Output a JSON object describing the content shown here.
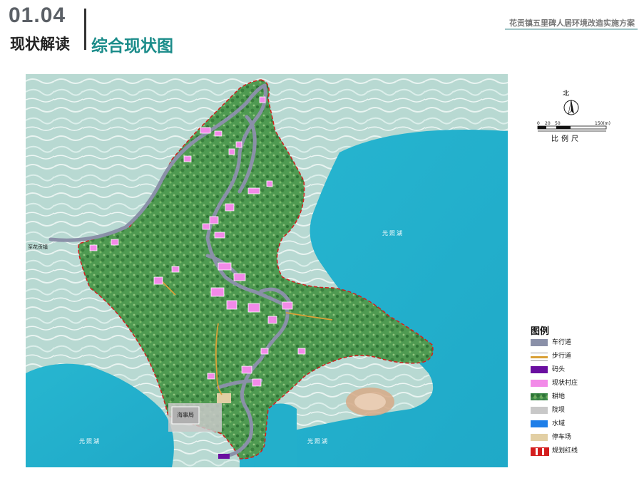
{
  "header": {
    "section_number": "01.04",
    "section_title": "现状解读",
    "page_title": "综合现状图",
    "project_title": "花贡镇五里碑人居环境改造实施方案"
  },
  "compass": {
    "north_label": "北"
  },
  "scale": {
    "ticks": [
      "0",
      "20",
      "50",
      "150(m)"
    ],
    "label": "比例尺"
  },
  "map_labels": {
    "lake_east": "光照湖",
    "lake_southwest": "光照湖",
    "lake_south": "光照湖",
    "road_destination": "至花贡镇",
    "building": "海事局"
  },
  "legend": {
    "title": "图例",
    "items": [
      {
        "label": "车行道",
        "color": "#8a90a8",
        "style": "solid"
      },
      {
        "label": "步行道",
        "color": "#d9a036",
        "style": "line"
      },
      {
        "label": "码头",
        "color": "#6a0fa0",
        "style": "solid"
      },
      {
        "label": "现状村庄",
        "color": "#f28ae8",
        "style": "solid"
      },
      {
        "label": "耕地",
        "color": "#3e8a4a",
        "style": "texture"
      },
      {
        "label": "院坝",
        "color": "#c8c8c8",
        "style": "solid"
      },
      {
        "label": "水域",
        "color": "#1e7ee8",
        "style": "solid"
      },
      {
        "label": "停车场",
        "color": "#e2cfa4",
        "style": "solid"
      },
      {
        "label": "规划红线",
        "color": "#d41e1e",
        "style": "dashed"
      }
    ]
  }
}
